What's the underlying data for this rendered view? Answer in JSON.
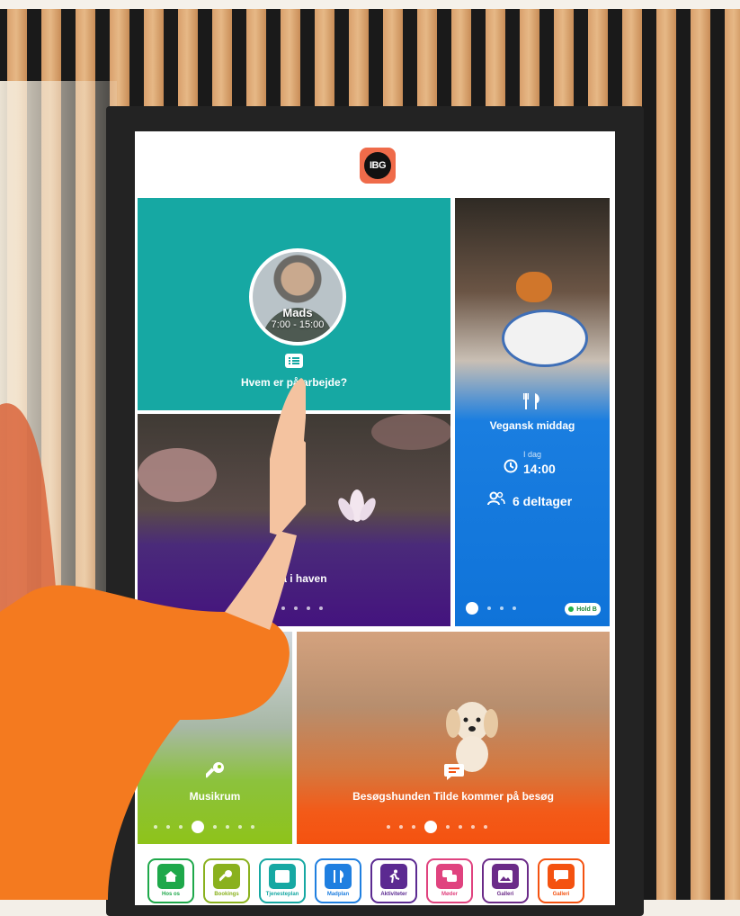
{
  "logo": {
    "text": "IBG"
  },
  "tiles": {
    "work": {
      "name": "Mads",
      "time": "7:00 - 15:00",
      "title": "Hvem er på arbejde?",
      "color": "#16a8a3"
    },
    "yoga": {
      "title": "Yoga i haven"
    },
    "food": {
      "title": "Vegansk middag",
      "day": "I dag",
      "time": "14:00",
      "participants": "6 deltager",
      "badge": "Hold B",
      "color": "#0f73d9"
    },
    "music": {
      "title": "Musikrum",
      "color": "#8ec31a"
    },
    "dog": {
      "title": "Besøgshunden Tilde kommer på besøg",
      "color": "#f45210"
    }
  },
  "nav": [
    {
      "label": "Hos os",
      "color": "#1ea84a",
      "icon": "home-icon"
    },
    {
      "label": "Bookings",
      "color": "#8ab11e",
      "icon": "key-icon"
    },
    {
      "label": "Tjenesteplan",
      "color": "#16a8a3",
      "icon": "list-icon"
    },
    {
      "label": "Madplan",
      "color": "#1f7fe0",
      "icon": "cutlery-icon"
    },
    {
      "label": "Aktiviteter",
      "color": "#5b2a91",
      "icon": "running-icon"
    },
    {
      "label": "Møder",
      "color": "#e0437f",
      "icon": "chat-icon"
    },
    {
      "label": "Galleri",
      "color": "#6b2b88",
      "icon": "gallery-icon"
    },
    {
      "label": "Galleri",
      "color": "#f45210",
      "icon": "message-icon"
    }
  ]
}
